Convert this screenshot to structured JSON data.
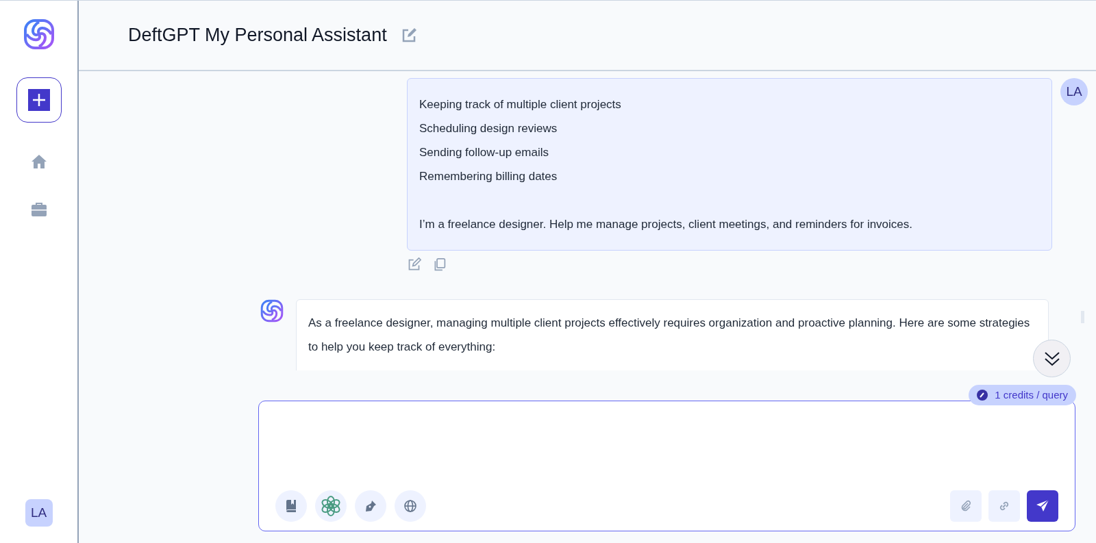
{
  "sidebar": {
    "avatar": "LA"
  },
  "header": {
    "title": "DeftGPT My Personal Assistant"
  },
  "user_message": {
    "avatar": "LA",
    "lines": [
      "Keeping track of multiple client projects",
      "Scheduling design reviews",
      "Sending follow-up emails",
      "Remembering billing dates"
    ],
    "request": "I’m a freelance designer. Help me manage projects, client meetings, and reminders for invoices."
  },
  "assistant_message": {
    "text": "As a freelance designer, managing multiple client projects effectively requires organization and proactive planning. Here are some strategies to help you keep track of everything:"
  },
  "composer": {
    "credits": "1 credits / query"
  }
}
